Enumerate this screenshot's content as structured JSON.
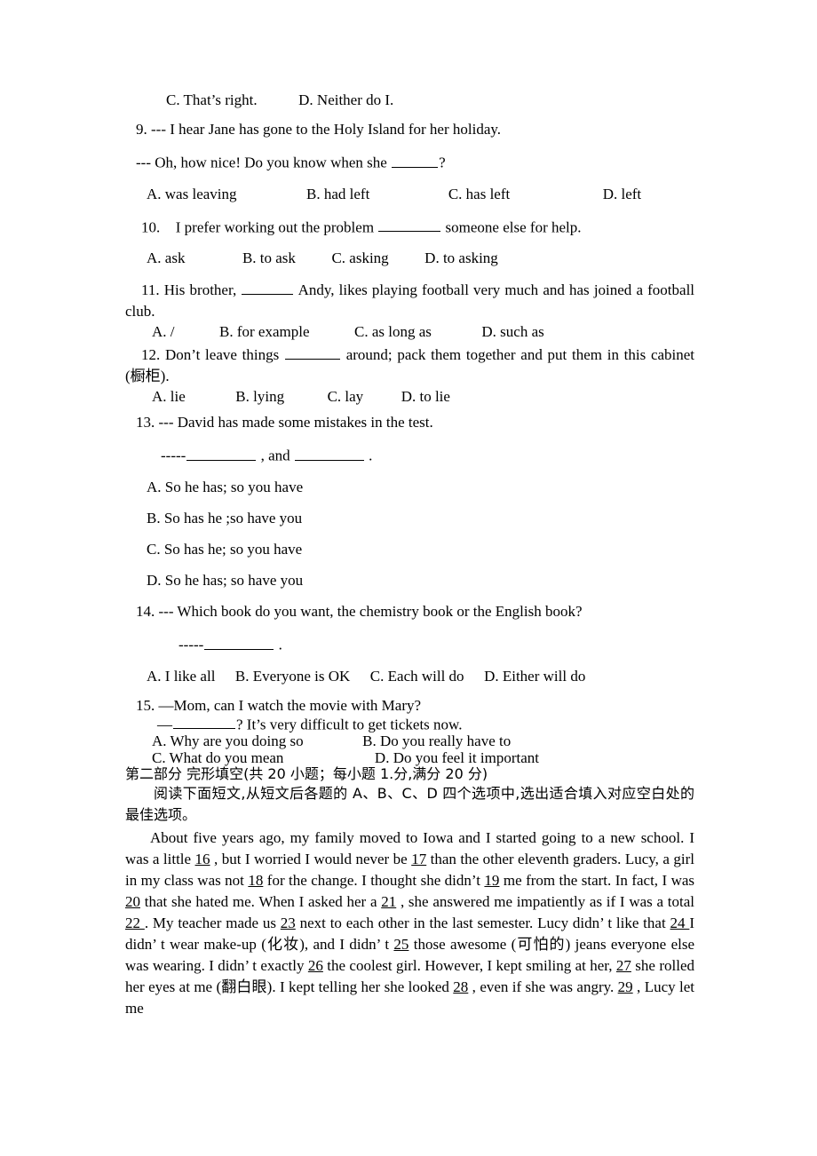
{
  "document": {
    "kind": "english-exam-paper-page",
    "language_note": "English exam with Chinese instructions"
  },
  "q8_tail": {
    "option_c": "C. That’s right.",
    "option_d": "D. Neither do I."
  },
  "questions": [
    {
      "number": "9.",
      "stem_lines": [
        "--- I hear Jane has gone to the Holy Island for her holiday.",
        "--- Oh, how nice! Do you know when she"
      ],
      "stem_tail": "?",
      "options": [
        "A. was leaving",
        "B. had left",
        "C. has left",
        "D. left"
      ]
    },
    {
      "number": "10.",
      "stem_pre": "I prefer working out the problem",
      "stem_post": "someone else for help.",
      "options": [
        "A. ask",
        "B. to ask",
        "C. asking",
        "D. to asking"
      ]
    },
    {
      "number": "11.",
      "stem_pre": "His brother,",
      "stem_post": "Andy, likes playing football very much and has joined a football club.",
      "options": [
        "A. /",
        "B. for example",
        "C. as long as",
        "D. such as"
      ]
    },
    {
      "number": "12.",
      "stem_pre": "Don’t leave things",
      "stem_post": "around; pack them together and put them in this cabinet (橱柜).",
      "options": [
        "A.   lie",
        "B. lying",
        "C. lay",
        "D. to lie"
      ]
    },
    {
      "number": "13.",
      "stem_lines": [
        "---  David has made some mistakes in the test."
      ],
      "answer_line_prefix": "-----",
      "answer_line_mid": ", and",
      "answer_line_end": ".",
      "options": [
        "A. So he has; so you have",
        "B. So has he ;so have you",
        "C. So has he; so you have",
        "D. So he has; so have you"
      ]
    },
    {
      "number": "14.",
      "stem_lines": [
        "---  Which book do you want, the chemistry book or the English book?"
      ],
      "answer_line_prefix": "-----",
      "answer_line_end": ".",
      "options": [
        "A. I like all",
        "B. Everyone is OK",
        "C. Each will do",
        "D. Either will do"
      ]
    },
    {
      "number": "15.",
      "stem_lines": [
        "—Mom, can I watch the movie with Mary?"
      ],
      "reply_prefix": "—",
      "reply_tail": "? It’s very difficult to get tickets now.",
      "options": [
        "A. Why are you doing so",
        "B. Do you really have to",
        "C. What do you mean",
        "D. Do you feel it important"
      ]
    }
  ],
  "part_two": {
    "heading": "第二部分  完形填空(共 20 小题；每小题 1.分,满分 20 分)",
    "instruction": "阅读下面短文,从短文后各题的 A、B、C、D 四个选项中,选出适合填入对应空白处的最佳选项。",
    "passage_parts": [
      {
        "t": "text",
        "v": "About five years ago, my family moved to Iowa and I started going to a new school. I was a little "
      },
      {
        "t": "num",
        "v": "16"
      },
      {
        "t": "text",
        "v": " , but I worried I would never be "
      },
      {
        "t": "num",
        "v": "17"
      },
      {
        "t": "text",
        "v": " than the other eleventh graders. Lucy, a girl in my class was not "
      },
      {
        "t": "num",
        "v": "18"
      },
      {
        "t": "text",
        "v": " for the change. I thought she didn’t "
      },
      {
        "t": "num",
        "v": "19"
      },
      {
        "t": "text",
        "v": " me from the start. In fact, I was "
      },
      {
        "t": "num",
        "v": "20"
      },
      {
        "t": "text",
        "v": " that she hated me. When I asked her a "
      },
      {
        "t": "num",
        "v": "21"
      },
      {
        "t": "text",
        "v": " , she answered me impatiently as if I was a total "
      },
      {
        "t": "num",
        "v": "22 "
      },
      {
        "t": "text",
        "v": ". My teacher made us "
      },
      {
        "t": "num",
        "v": "23"
      },
      {
        "t": "text",
        "v": " next to each other in the last semester. Lucy didn’ t like that "
      },
      {
        "t": "num",
        "v": "24 "
      },
      {
        "t": "text",
        "v": "I didn’ t wear make-up (化妆), and I didn’ t  "
      },
      {
        "t": "num",
        "v": "25"
      },
      {
        "t": "text",
        "v": " those awesome (可怕的) jeans everyone else was wearing. I didn’ t exactly "
      },
      {
        "t": "num",
        "v": "26"
      },
      {
        "t": "text",
        "v": " the coolest girl. However, I kept smiling at her, "
      },
      {
        "t": "num",
        "v": "27"
      },
      {
        "t": "text",
        "v": " she rolled her eyes at me (翻白眼). I kept telling her she looked "
      },
      {
        "t": "num",
        "v": "28"
      },
      {
        "t": "text",
        "v": " , even if she was angry. "
      },
      {
        "t": "num",
        "v": "29"
      },
      {
        "t": "text",
        "v": " , Lucy let me"
      }
    ]
  }
}
